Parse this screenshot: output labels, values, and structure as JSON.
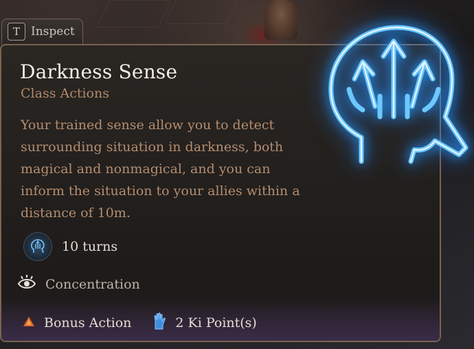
{
  "tooltip": {
    "inspect_key": "T",
    "inspect_label": "Inspect",
    "title": "Darkness Sense",
    "subtitle": "Class Actions",
    "description": "Your trained sense allow you to detect surrounding situation in darkness, both magical and nonmagical, and you can inform the situation to your allies within a distance of 10m.",
    "duration": "10 turns",
    "concentration": "Concentration",
    "action_type": "Bonus Action",
    "cost": "2 Ki Point(s)"
  },
  "icons": {
    "spell_emblem": "glowing-head-arrows-icon",
    "duration": "duration-head-icon",
    "concentration": "concentration-eye-icon",
    "action": "bonus-action-triangle-icon",
    "ki": "ki-hand-icon"
  },
  "colors": {
    "title": "#f1ece6",
    "subtitle": "#b08a6c",
    "description": "#b58d6f",
    "emblem_glow": "#2a9cff",
    "bonus_action": "#e0662a",
    "ki": "#3f8fe0",
    "border": "#7a6450"
  }
}
